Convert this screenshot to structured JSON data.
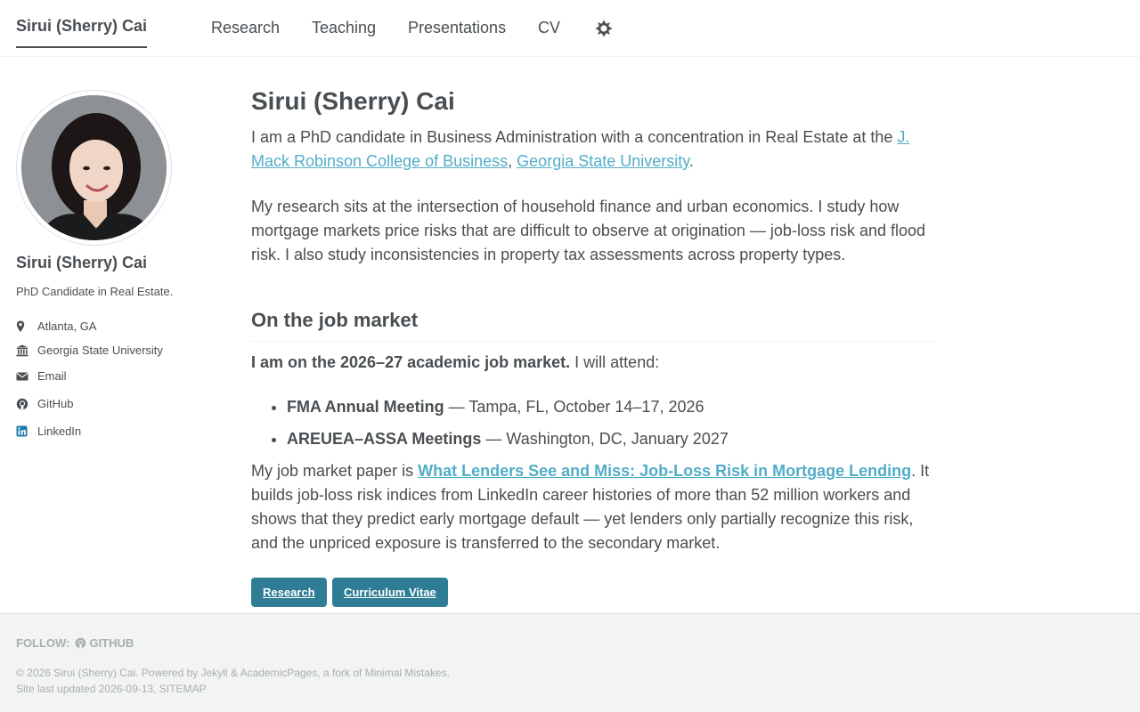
{
  "masthead": {
    "site_title": "Sirui (Sherry) Cai",
    "nav": [
      {
        "label": "Research"
      },
      {
        "label": "Teaching"
      },
      {
        "label": "Presentations"
      },
      {
        "label": "CV"
      }
    ],
    "theme_icon": "sun-icon"
  },
  "sidebar": {
    "name": "Sirui (Sherry) Cai",
    "bio": "PhD Candidate in Real Estate.",
    "links": [
      {
        "icon": "map-marker-icon",
        "label": "Atlanta, GA"
      },
      {
        "icon": "university-icon",
        "label": "Georgia State University"
      },
      {
        "icon": "envelope-icon",
        "label": "Email"
      },
      {
        "icon": "github-icon",
        "label": "GitHub"
      },
      {
        "icon": "linkedin-icon",
        "label": "LinkedIn"
      }
    ]
  },
  "main": {
    "title": "Sirui (Sherry) Cai",
    "intro": {
      "prefix": "I am a PhD candidate in Business Administration with a concentration in Real Estate at the ",
      "link1": "J. Mack Robinson College of Business",
      "sep": ", ",
      "link2": "Georgia State University",
      "suffix": "."
    },
    "research_paragraph": "My research sits at the intersection of household finance and urban economics. I study how mortgage markets price risks that are difficult to observe at origination — job-loss risk and flood risk. I also study inconsistencies in property tax assessments across property types.",
    "job_market": {
      "heading": "On the job market",
      "statement_bold": "I am on the 2026–27 academic job market.",
      "statement_rest": " I will attend:",
      "events": [
        {
          "name": "FMA Annual Meeting",
          "detail": " — Tampa, FL, October 14–17, 2026"
        },
        {
          "name": "AREUEA–ASSA Meetings",
          "detail": " — Washington, DC, January 2027"
        }
      ],
      "paper_prefix": "My job market paper is ",
      "paper_title": "What Lenders See and Miss: Job-Loss Risk in Mortgage Lending",
      "paper_suffix": ". It builds job-loss risk indices from LinkedIn career histories of more than 52 million workers and shows that they predict early mortgage default — yet lenders only partially recognize this risk, and the unpriced exposure is transferred to the secondary market."
    },
    "buttons": [
      {
        "label": "Research"
      },
      {
        "label": "Curriculum Vitae"
      }
    ]
  },
  "footer": {
    "follow_label": "FOLLOW:",
    "follow_github": "GITHUB",
    "copyright_prefix": "© 2026 Sirui (Sherry) Cai. Powered by ",
    "jekyll": "Jekyll",
    "amp": " & ",
    "academicpages": "AcademicPages",
    "fork_text": ", a fork of ",
    "minimal_mistakes": "Minimal Mistakes",
    "period": ".",
    "updated": "Site last updated 2026-09-13, ",
    "sitemap": "SITEMAP"
  },
  "colors": {
    "text": "#494e52",
    "link": "#52adc8",
    "button": "#2f7d95",
    "footer_bg": "#f2f3f3",
    "footer_text": "#a9aeb1"
  }
}
